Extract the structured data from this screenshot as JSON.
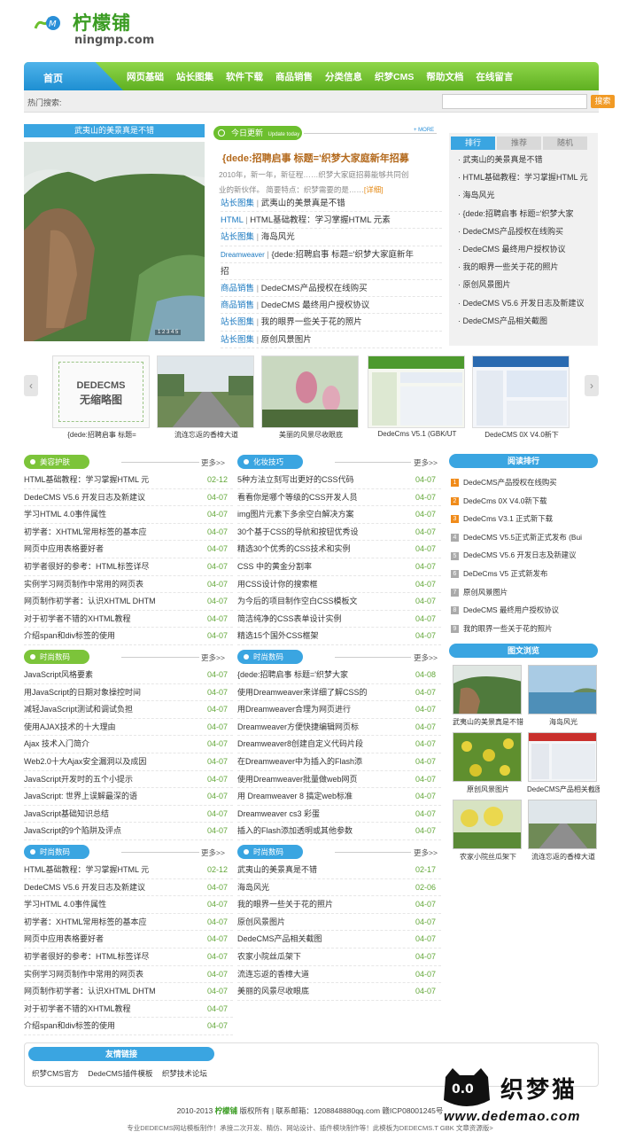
{
  "logo": {
    "cn": "柠檬铺",
    "en": "ningmp.com"
  },
  "nav": {
    "home": "首页",
    "items": [
      "网页基础",
      "站长图集",
      "软件下载",
      "商品销售",
      "分类信息",
      "织梦CMS",
      "帮助文档",
      "在线留言"
    ]
  },
  "search": {
    "label": "热门搜索:",
    "value": "",
    "button": "搜索"
  },
  "featured": {
    "title": "武夷山的美景真是不错",
    "dots": "1 2 3 4 5"
  },
  "news": {
    "tag": "今日更新",
    "tag_en": "Update today",
    "more": "+ MORE",
    "headline": "{dede:招聘启事 标题='织梦大家庭新年招募",
    "desc1": "2010年，新一年，新征程……织梦大家庭招募能够共同创",
    "desc2": "业的新伙伴。  简要特点：织梦需要的是……",
    "detail": "[详细]",
    "items": [
      {
        "cat": "站长图集",
        "title": "武夷山的美景真是不错"
      },
      {
        "cat": "HTML",
        "title": "HTML基础教程：学习掌握HTML 元素"
      },
      {
        "cat": "站长图集",
        "title": "海岛风光"
      },
      {
        "cat": "Dreamweaver",
        "title": "{dede:招聘启事 标题='织梦大家庭新年"
      },
      {
        "cat": "",
        "title": "招"
      },
      {
        "cat": "商品销售",
        "title": "DedeCMS产品授权在线购买"
      },
      {
        "cat": "商品销售",
        "title": "DedeCMS 最终用户授权协议"
      },
      {
        "cat": "站长图集",
        "title": "我的眼界一些关于花的照片"
      },
      {
        "cat": "站长图集",
        "title": "原创风景图片"
      }
    ]
  },
  "rank": {
    "tabs": [
      "排行",
      "推荐",
      "随机"
    ],
    "items": [
      "武夷山的美景真是不错",
      "HTML基础教程：学习掌握HTML 元",
      "海岛风光",
      "{dede:招聘启事 标题='织梦大家",
      "DedeCMS产品授权在线购买",
      "DedeCMS 最终用户授权协议",
      "我的眼界一些关于花的照片",
      "原创风景图片",
      "DedeCMS V5.6 开发日志及新建议",
      "DedeCMS产品相关截图"
    ]
  },
  "carousel": {
    "placeholder1": "DEDECMS",
    "placeholder2": "无缩略图",
    "captions": [
      "{dede:招聘启事 标题=",
      "流连忘返的香樟大道",
      "美丽的风景尽收眼底",
      "DedeCms V5.1 (GBK/UT",
      "DedeCMS 0X V4.0新下"
    ]
  },
  "lists": [
    {
      "title": "美容护肤",
      "more": "更多>>",
      "items": [
        {
          "t": "HTML基础教程：学习掌握HTML 元",
          "d": "02-12"
        },
        {
          "t": "DedeCMS V5.6 开发日志及新建议",
          "d": "04-07"
        },
        {
          "t": "学习HTML 4.0事件属性",
          "d": "04-07"
        },
        {
          "t": "初学者：XHTML常用标签的基本应",
          "d": "04-07"
        },
        {
          "t": "网页中应用表格要好者",
          "d": "04-07"
        },
        {
          "t": "初学者很好的参考：HTML标签详尽",
          "d": "04-07"
        },
        {
          "t": "实例学习网页制作中常用的网页表",
          "d": "04-07"
        },
        {
          "t": "网页制作初学者：认识XHTML DHTM",
          "d": "04-07"
        },
        {
          "t": "对于初学者不错的XHTML教程",
          "d": "04-07"
        },
        {
          "t": "介绍span和div标签的使用",
          "d": "04-07"
        }
      ]
    },
    {
      "title": "化妆技巧",
      "more": "更多>>",
      "items": [
        {
          "t": "5种方法立刻写出更好的CSS代码",
          "d": "04-07"
        },
        {
          "t": "看看你是哪个等级的CSS开发人员",
          "d": "04-07"
        },
        {
          "t": "img图片元素下多余空白解决方案",
          "d": "04-07"
        },
        {
          "t": "30个基于CSS的导航和按钮优秀设",
          "d": "04-07"
        },
        {
          "t": "精选30个优秀的CSS技术和实例",
          "d": "04-07"
        },
        {
          "t": "CSS 中的黄金分割率",
          "d": "04-07"
        },
        {
          "t": "用CSS设计你的搜索框",
          "d": "04-07"
        },
        {
          "t": "为今后的项目制作空白CSS模板文",
          "d": "04-07"
        },
        {
          "t": "简洁纯净的CSS表单设计实例",
          "d": "04-07"
        },
        {
          "t": "精选15个国外CSS框架",
          "d": "04-07"
        }
      ]
    },
    {
      "title": "时尚数码",
      "more": "更多>>",
      "items": [
        {
          "t": "JavaScript风格要素",
          "d": "04-07"
        },
        {
          "t": "用JavaScript的日期对象操控时间",
          "d": "04-07"
        },
        {
          "t": "减轻JavaScript测试和调试负担",
          "d": "04-07"
        },
        {
          "t": "使用AJAX技术的十大理由",
          "d": "04-07"
        },
        {
          "t": "Ajax 技术入门简介",
          "d": "04-07"
        },
        {
          "t": "Web2.0十大Ajax安全漏洞以及成因",
          "d": "04-07"
        },
        {
          "t": "JavaScript开发时的五个小提示",
          "d": "04-07"
        },
        {
          "t": "JavaScript: 世界上误解最深的语",
          "d": "04-07"
        },
        {
          "t": "JavaScript基础知识总结",
          "d": "04-07"
        },
        {
          "t": "JavaScript的9个陷阱及评点",
          "d": "04-07"
        }
      ]
    },
    {
      "title": "时尚数码",
      "more": "更多>>",
      "items": [
        {
          "t": "{dede:招聘启事 标题='织梦大家",
          "d": "04-08"
        },
        {
          "t": "使用Dreamweaver来详细了解CSS的",
          "d": "04-07"
        },
        {
          "t": "用Dreamweaver合理为网页进行",
          "d": "04-07"
        },
        {
          "t": "Dreamweaver方便快捷编辑网页标",
          "d": "04-07"
        },
        {
          "t": "Dreamweaver8创建自定义代码片段",
          "d": "04-07"
        },
        {
          "t": "在Dreamweaver中为插入的Flash添",
          "d": "04-07"
        },
        {
          "t": "使用Dreamweaver批量做web网页",
          "d": "04-07"
        },
        {
          "t": "用 Dreamweaver 8 搞定web标准",
          "d": "04-07"
        },
        {
          "t": "Dreamweaver cs3 彩蛋",
          "d": "04-07"
        },
        {
          "t": "插入的Flash添加透明或其他参数",
          "d": "04-07"
        }
      ]
    },
    {
      "title": "时尚数码",
      "more": "更多>>",
      "items": [
        {
          "t": "HTML基础教程：学习掌握HTML 元",
          "d": "02-12"
        },
        {
          "t": "DedeCMS V5.6 开发日志及新建议",
          "d": "04-07"
        },
        {
          "t": "学习HTML 4.0事件属性",
          "d": "04-07"
        },
        {
          "t": "初学者：XHTML常用标签的基本应",
          "d": "04-07"
        },
        {
          "t": "网页中应用表格要好者",
          "d": "04-07"
        },
        {
          "t": "初学者很好的参考：HTML标签详尽",
          "d": "04-07"
        },
        {
          "t": "实例学习网页制作中常用的网页表",
          "d": "04-07"
        },
        {
          "t": "网页制作初学者：认识XHTML DHTM",
          "d": "04-07"
        },
        {
          "t": "对于初学者不错的XHTML教程",
          "d": "04-07"
        },
        {
          "t": "介绍span和div标签的使用",
          "d": "04-07"
        }
      ]
    },
    {
      "title": "时尚数码",
      "more": "更多>>",
      "items": [
        {
          "t": "武夷山的美景真是不错",
          "d": "02-17"
        },
        {
          "t": "海岛风光",
          "d": "02-06"
        },
        {
          "t": "我的眼界一些关于花的照片",
          "d": "04-07"
        },
        {
          "t": "原创风景图片",
          "d": "04-07"
        },
        {
          "t": "DedeCMS产品相关截图",
          "d": "04-07"
        },
        {
          "t": "农家小院丝瓜架下",
          "d": "04-07"
        },
        {
          "t": "流连忘返的香樟大道",
          "d": "04-07"
        },
        {
          "t": "美丽的风景尽收眼底",
          "d": "04-07"
        }
      ]
    }
  ],
  "reading": {
    "title": "阅读排行",
    "items": [
      "DedeCMS产品授权在线购买",
      "DedeCms 0X V4.0新下载",
      "DedeCms V3.1 正式新下载",
      "DedeCMS V5.5正式新正式发布 (Bui",
      "DedeCMS V5.6 开发日志及新建议",
      "DeDeCms V5 正式新发布",
      "原创风景图片",
      "DedeCMS 最终用户授权协议",
      "我的眼界一些关于花的照片"
    ]
  },
  "gallery": {
    "title": "图文浏览",
    "captions": [
      "武夷山的美景真是不错",
      "海岛风光",
      "原创风景图片",
      "DedeCMS产品相关截图",
      "农家小院丝瓜架下",
      "流连忘返的香樟大道"
    ]
  },
  "links": {
    "title": "友情链接",
    "items": [
      "织梦CMS官方",
      "DedeCMS插件模板",
      "织梦技术论坛"
    ]
  },
  "footer": {
    "pre": "2010-2013",
    "brand": "柠檬铺",
    "post": "版权所有  |  联系邮箱：1208848880qq.com  赣ICP08001245号",
    "line2": "专业DEDECMS网站模板制作！承接二次开发、精仿、网站设计、插件模块制作等！此模板为DEDECMS.T GBK 文章资源版>"
  },
  "watermark": {
    "cn": "织梦猫",
    "url": "www.dedemao.com"
  },
  "colors": {
    "green": "#7cc43a",
    "blue": "#3aa5e1",
    "date": "#63a83a",
    "orange": "#f19a25"
  }
}
